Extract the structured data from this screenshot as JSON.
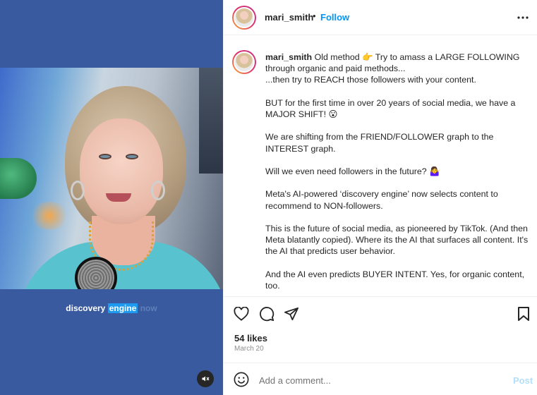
{
  "video": {
    "caption_before": "discovery",
    "caption_highlight": "engine",
    "caption_after": "now",
    "mute_icon": "speaker-muted-icon"
  },
  "header": {
    "username": "mari_smith",
    "separator": "•",
    "follow_label": "Follow",
    "more_icon": "more-horizontal-icon"
  },
  "caption": {
    "username": "mari_smith",
    "paragraphs": [
      "Old method 👉 Try to amass a LARGE FOLLOWING through organic and paid methods...\n...then try to REACH those followers with your content.",
      "BUT for the first time in over 20 years of social media, we have a MAJOR SHIFT! 😮",
      "We are shifting from the FRIEND/FOLLOWER graph to the INTEREST graph.",
      "Will we even need followers in the future? 🤷‍♀️",
      "Meta's AI-powered ‘discovery engine’ now selects content to recommend to NON-followers.",
      "This is the future of social media, as pioneered by TikTok. (And then Meta blatantly copied). Where its the AI that surfaces all content. It's the AI that predicts user behavior.",
      "And the AI even predicts BUYER INTENT. Yes, for organic content, too."
    ]
  },
  "actions": {
    "like_icon": "heart-icon",
    "comment_icon": "comment-icon",
    "share_icon": "share-icon",
    "save_icon": "bookmark-icon"
  },
  "likes_text": "54 likes",
  "date_text": "March 20",
  "comment": {
    "emoji_icon": "emoji-icon",
    "placeholder": "Add a comment...",
    "value": "",
    "post_label": "Post"
  },
  "colors": {
    "video_bg": "#3a5aa0",
    "link_blue": "#0095f6",
    "post_disabled": "#b2dffc",
    "caption_highlight": "#1e9bf0"
  }
}
